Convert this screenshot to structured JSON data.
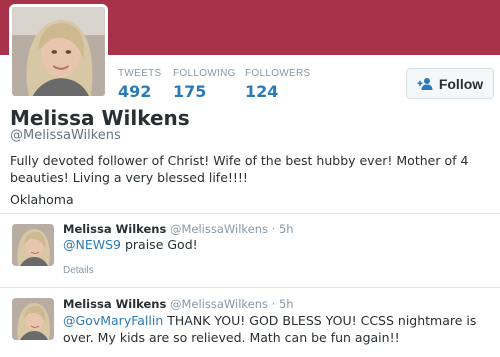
{
  "profile": {
    "name": "Melissa Wilkens",
    "handle": "@MelissaWilkens",
    "bio": "Fully devoted follower of Christ! Wife of the best hubby ever! Mother of 4 beauties! Living a very blessed life!!!!",
    "location": "Oklahoma",
    "avatar_icon": "profile-photo",
    "banner_color": "#a8324a"
  },
  "stats": [
    {
      "label": "TWEETS",
      "value": "492"
    },
    {
      "label": "FOLLOWING",
      "value": "175"
    },
    {
      "label": "FOLLOWERS",
      "value": "124"
    }
  ],
  "follow_button": {
    "label": "Follow",
    "icon": "add-user-icon"
  },
  "tweets": [
    {
      "name": "Melissa Wilkens",
      "handle": "@MelissaWilkens",
      "separator": "·",
      "time": "5h",
      "mention": "@NEWS9",
      "text": " praise God!",
      "details": "Details"
    },
    {
      "name": "Melissa Wilkens",
      "handle": "@MelissaWilkens",
      "separator": "·",
      "time": "5h",
      "mention": "@GovMaryFallin",
      "text": " THANK YOU! GOD BLESS YOU! CCSS nightmare is over. My kids are so relieved. Math can be fun again!!"
    }
  ],
  "colors": {
    "link": "#2b7bb9",
    "muted": "#8899a6",
    "text": "#292f33"
  }
}
